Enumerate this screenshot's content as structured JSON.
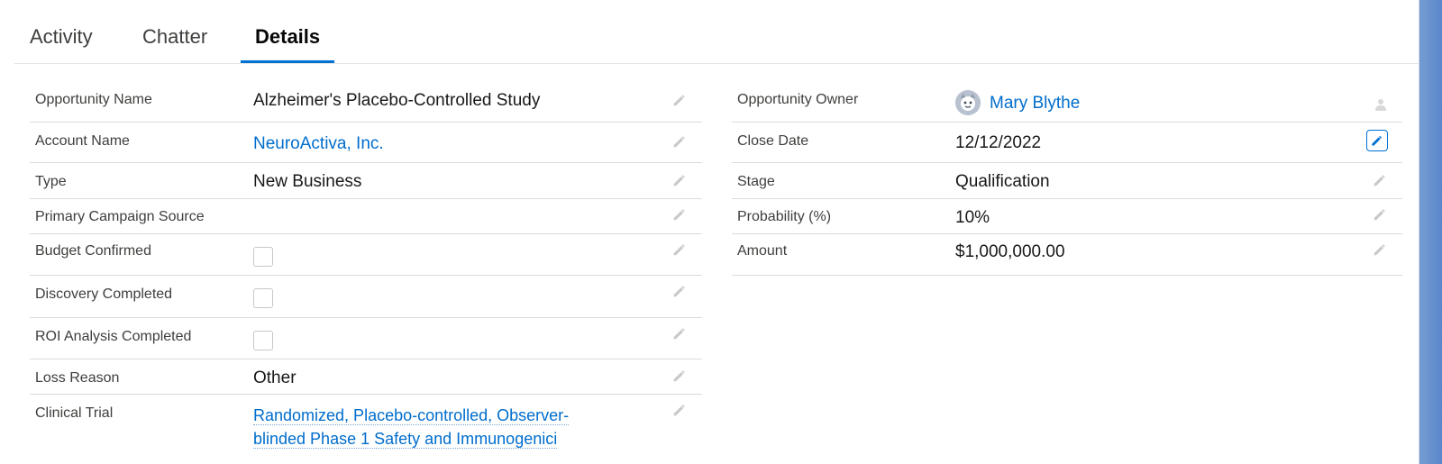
{
  "tabs": [
    {
      "label": "Activity"
    },
    {
      "label": "Chatter"
    },
    {
      "label": "Details",
      "active": true
    }
  ],
  "left_fields": {
    "opportunity_name": {
      "label": "Opportunity Name",
      "value": "Alzheimer's Placebo-Controlled Study"
    },
    "account_name": {
      "label": "Account Name",
      "value": "NeuroActiva, Inc."
    },
    "type": {
      "label": "Type",
      "value": "New Business"
    },
    "primary_campaign_source": {
      "label": "Primary Campaign Source",
      "value": ""
    },
    "budget_confirmed": {
      "label": "Budget Confirmed",
      "checked": false
    },
    "discovery_completed": {
      "label": "Discovery Completed",
      "checked": false
    },
    "roi_analysis_completed": {
      "label": "ROI Analysis Completed",
      "checked": false
    },
    "loss_reason": {
      "label": "Loss Reason",
      "value": "Other"
    },
    "clinical_trial": {
      "label": "Clinical Trial",
      "value_line1": "Randomized, Placebo-controlled, Observer-",
      "value_line2": "blinded Phase 1 Safety and Immunogenici"
    }
  },
  "right_fields": {
    "opportunity_owner": {
      "label": "Opportunity Owner",
      "value": "Mary Blythe"
    },
    "close_date": {
      "label": "Close Date",
      "value": "12/12/2022"
    },
    "stage": {
      "label": "Stage",
      "value": "Qualification"
    },
    "probability": {
      "label": "Probability (%)",
      "value": "10%"
    },
    "amount": {
      "label": "Amount",
      "value": "$1,000,000.00"
    }
  },
  "colors": {
    "link": "#006dcc",
    "accent": "#0070d2",
    "edit_icon": "#c9c9c9",
    "border": "#dddbda"
  },
  "icons": {
    "edit": "pencil-icon",
    "owner_avatar": "avatar-icon",
    "change_owner": "person-icon"
  }
}
